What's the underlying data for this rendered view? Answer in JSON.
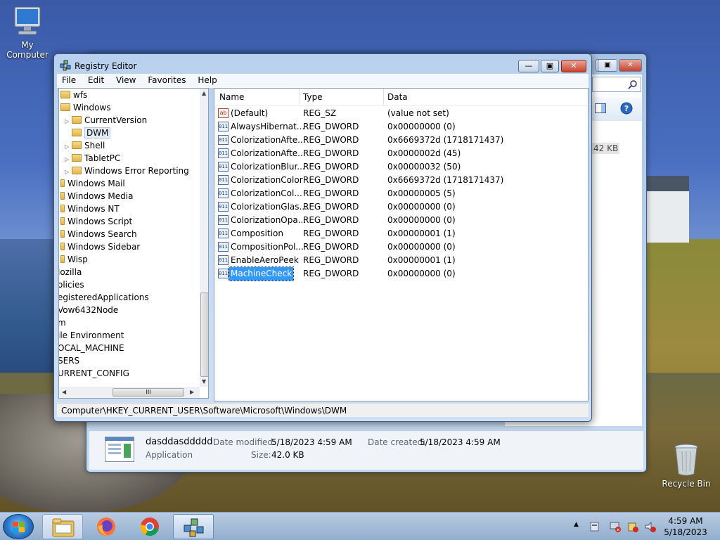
{
  "desktop": {
    "icons": [
      {
        "label": "My Computer",
        "icon": "computer-icon"
      },
      {
        "label": "Recycle Bin",
        "icon": "recycle-bin-icon"
      }
    ]
  },
  "background_window": {
    "size_pill": "42 KB",
    "details": {
      "file_name": "dasddasddddd",
      "file_type": "Application",
      "date_modified_label": "Date modified:",
      "date_modified": "5/18/2023 4:59 AM",
      "date_created_label": "Date created:",
      "date_created": "5/18/2023 4:59 AM",
      "size_label": "Size:",
      "size": "42.0 KB"
    }
  },
  "registry": {
    "title": "Registry Editor",
    "menu": [
      "File",
      "Edit",
      "View",
      "Favorites",
      "Help"
    ],
    "tree": [
      {
        "label": "wfs",
        "level": 0
      },
      {
        "label": "Windows",
        "level": 0
      },
      {
        "label": "CurrentVersion",
        "level": 1
      },
      {
        "label": "DWM",
        "level": 1,
        "selected": true
      },
      {
        "label": "Shell",
        "level": 1
      },
      {
        "label": "TabletPC",
        "level": 1
      },
      {
        "label": "Windows Error Reporting",
        "level": 1
      },
      {
        "label": "Windows Mail",
        "level": 0
      },
      {
        "label": "Windows Media",
        "level": 0
      },
      {
        "label": "Windows NT",
        "level": 0
      },
      {
        "label": "Windows Script",
        "level": 0
      },
      {
        "label": "Windows Search",
        "level": 0
      },
      {
        "label": "Windows Sidebar",
        "level": 0
      },
      {
        "label": "Wisp",
        "level": 0
      },
      {
        "label": "lozilla",
        "level": -1
      },
      {
        "label": "olicies",
        "level": -1
      },
      {
        "label": "egisteredApplications",
        "level": -1
      },
      {
        "label": "Vow6432Node",
        "level": -1
      },
      {
        "label": "m",
        "level": -1
      },
      {
        "label": "ile Environment",
        "level": -1
      },
      {
        "label": "OCAL_MACHINE",
        "level": -1
      },
      {
        "label": "SERS",
        "level": -1
      },
      {
        "label": "URRENT_CONFIG",
        "level": -1
      }
    ],
    "columns": {
      "name": "Name",
      "type": "Type",
      "data": "Data"
    },
    "values": [
      {
        "name": "(Default)",
        "type": "REG_SZ",
        "data": "(value not set)",
        "kind": "sz"
      },
      {
        "name": "AlwaysHibernat...",
        "type": "REG_DWORD",
        "data": "0x00000000 (0)",
        "kind": "bin"
      },
      {
        "name": "ColorizationAfte...",
        "type": "REG_DWORD",
        "data": "0x6669372d (1718171437)",
        "kind": "bin"
      },
      {
        "name": "ColorizationAfte...",
        "type": "REG_DWORD",
        "data": "0x0000002d (45)",
        "kind": "bin"
      },
      {
        "name": "ColorizationBlur...",
        "type": "REG_DWORD",
        "data": "0x00000032 (50)",
        "kind": "bin"
      },
      {
        "name": "ColorizationColor",
        "type": "REG_DWORD",
        "data": "0x6669372d (1718171437)",
        "kind": "bin"
      },
      {
        "name": "ColorizationCol...",
        "type": "REG_DWORD",
        "data": "0x00000005 (5)",
        "kind": "bin"
      },
      {
        "name": "ColorizationGlas...",
        "type": "REG_DWORD",
        "data": "0x00000000 (0)",
        "kind": "bin"
      },
      {
        "name": "ColorizationOpa...",
        "type": "REG_DWORD",
        "data": "0x00000000 (0)",
        "kind": "bin"
      },
      {
        "name": "Composition",
        "type": "REG_DWORD",
        "data": "0x00000001 (1)",
        "kind": "bin"
      },
      {
        "name": "CompositionPol...",
        "type": "REG_DWORD",
        "data": "0x00000000 (0)",
        "kind": "bin"
      },
      {
        "name": "EnableAeroPeek",
        "type": "REG_DWORD",
        "data": "0x00000001 (1)",
        "kind": "bin"
      },
      {
        "name": "MachineCheck",
        "type": "REG_DWORD",
        "data": "0x00000000 (0)",
        "kind": "bin",
        "selected": true
      }
    ],
    "status_path": "Computer\\HKEY_CURRENT_USER\\Software\\Microsoft\\Windows\\DWM",
    "scroll_glyph": "III",
    "value_icon_sz": "ab",
    "value_icon_bin": "011"
  },
  "taskbar": {
    "clock_time": "4:59 AM",
    "clock_date": "5/18/2023",
    "buttons": [
      "explorer-icon",
      "firefox-icon",
      "chrome-icon",
      "regedit-icon"
    ]
  }
}
